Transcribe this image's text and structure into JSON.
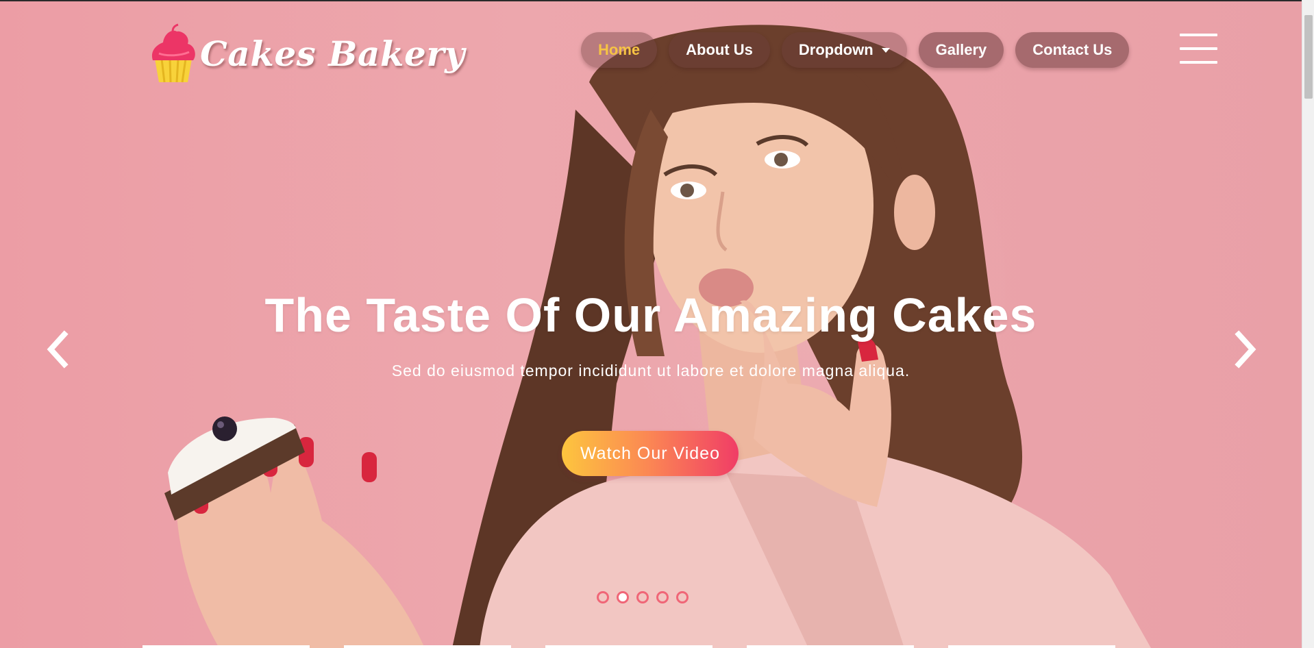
{
  "brand": {
    "name": "Cakes Bakery",
    "logo_icon": "cupcake-icon"
  },
  "nav": {
    "items": [
      {
        "label": "Home",
        "active": true
      },
      {
        "label": "About Us",
        "active": false
      },
      {
        "label": "Dropdown",
        "active": false,
        "has_caret": true
      },
      {
        "label": "Gallery",
        "active": false
      },
      {
        "label": "Contact Us",
        "active": false
      }
    ],
    "menu_icon": "hamburger-menu-icon"
  },
  "hero": {
    "headline": "The Taste Of Our Amazing Cakes",
    "subline": "Sed do eiusmod tempor incididunt ut labore et dolore magna aliqua.",
    "cta_label": "Watch Our Video",
    "prev_icon": "chevron-left-icon",
    "next_icon": "chevron-right-icon",
    "slide_count": 5,
    "active_slide": 2
  },
  "colors": {
    "background": "#e9a2a8",
    "nav_active_text": "#f6c344",
    "cta_gradient_start": "#fdc53e",
    "cta_gradient_end": "#f03d66",
    "indicator": "#f06677"
  }
}
